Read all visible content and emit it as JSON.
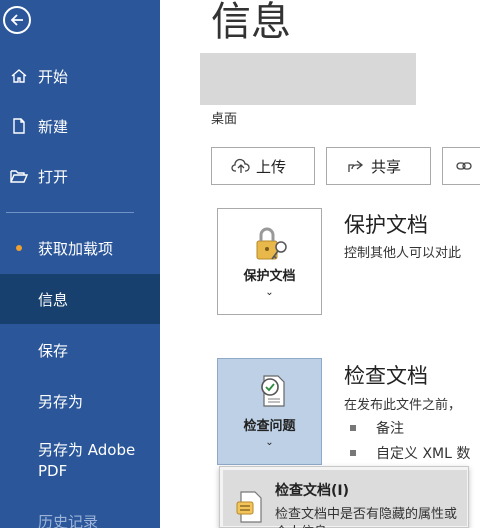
{
  "sidebar": {
    "back_icon": "back-arrow-icon",
    "items": [
      {
        "label": "开始",
        "icon": "home-icon"
      },
      {
        "label": "新建",
        "icon": "new-document-icon"
      },
      {
        "label": "打开",
        "icon": "open-folder-icon"
      },
      {
        "label": "获取加载项",
        "icon": "dot-icon"
      },
      {
        "label": "信息",
        "selected": true
      },
      {
        "label": "保存"
      },
      {
        "label": "另存为"
      },
      {
        "label": "另存为 Adobe PDF"
      },
      {
        "label": "历史记录"
      }
    ],
    "accent_color": "#2b579a",
    "selected_color": "#17406e"
  },
  "main": {
    "title": "信息",
    "location": "桌面",
    "buttons": [
      {
        "label": "上传",
        "icon": "upload-cloud-icon"
      },
      {
        "label": "共享",
        "icon": "share-icon"
      },
      {
        "label": "",
        "icon": "link-icon"
      }
    ],
    "protect": {
      "card_label": "保护文档",
      "title": "保护文档",
      "description": "控制其他人可以对此"
    },
    "inspect": {
      "card_label": "检查问题",
      "title": "检查文档",
      "description": "在发布此文件之前，",
      "bullets": [
        "备注",
        "自定义 XML 数"
      ]
    }
  },
  "dropdown": {
    "title": "检查文档(I)",
    "description": "检查文档中是否有隐藏的属性或个人信息。"
  }
}
